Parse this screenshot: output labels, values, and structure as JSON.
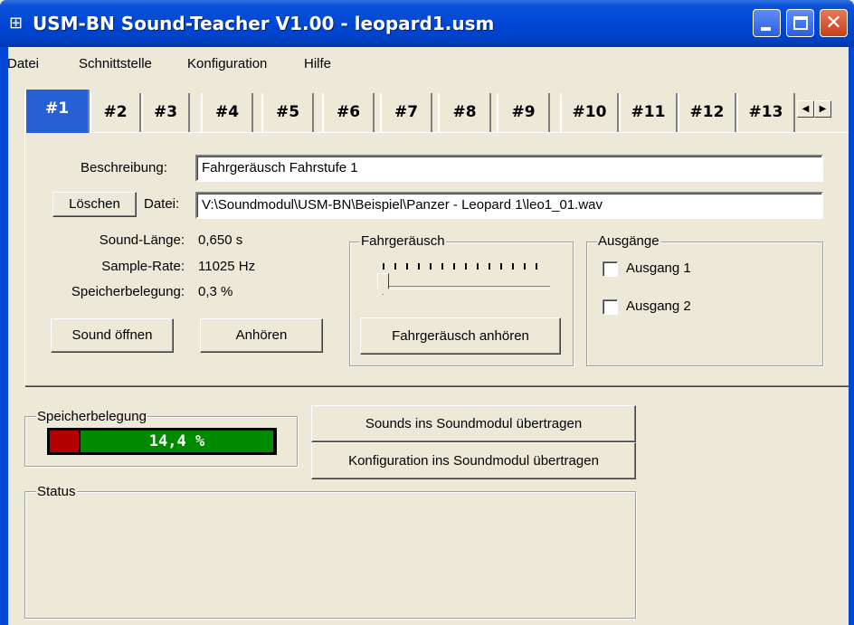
{
  "window": {
    "title": "USM-BN Sound-Teacher V1.00 - leopard1.usm",
    "icon": "app-icon"
  },
  "menu": [
    "Datei",
    "Schnittstelle",
    "Konfiguration",
    "Hilfe"
  ],
  "tabs": [
    "#1",
    "#2",
    "#3",
    "#4",
    "#5",
    "#6",
    "#7",
    "#8",
    "#9",
    "#10",
    "#11",
    "#12",
    "#13"
  ],
  "active_tab": "#1",
  "sound": {
    "beschreibung_label": "Beschreibung:",
    "beschreibung_value": "Fahrgeräusch Fahrstufe 1",
    "loeschen_button": "Löschen",
    "datei_label": "Datei:",
    "datei_value": "V:\\Soundmodul\\USM-BN\\Beispiel\\Panzer - Leopard 1\\leo1_01.wav",
    "info": [
      {
        "label": "Sound-Länge:",
        "value": "0,650 s"
      },
      {
        "label": "Sample-Rate:",
        "value": "11025 Hz"
      },
      {
        "label": "Speicherbelegung:",
        "value": "0,3 %"
      }
    ],
    "open_button": "Sound öffnen",
    "listen_button": "Anhören"
  },
  "fahrgeraeusch": {
    "title": "Fahrgeräusch",
    "slider_level": 0,
    "listen_button": "Fahrgeräusch anhören"
  },
  "ausgaenge": {
    "title": "Ausgänge",
    "outputs": [
      {
        "label": "Ausgang 1",
        "checked": false
      },
      {
        "label": "Ausgang 2",
        "checked": false
      }
    ]
  },
  "speicher": {
    "title": "Speicherbelegung",
    "value_text": "14,4 %",
    "percent": 14.4
  },
  "actions": {
    "transfer_sounds": "Sounds ins Soundmodul übertragen",
    "transfer_config": "Konfiguration ins Soundmodul übertragen"
  },
  "status": {
    "title": "Status"
  },
  "colors": {
    "titlebar": "#0047d6",
    "progress_used": "#b30000",
    "progress_fill": "#008a00"
  }
}
